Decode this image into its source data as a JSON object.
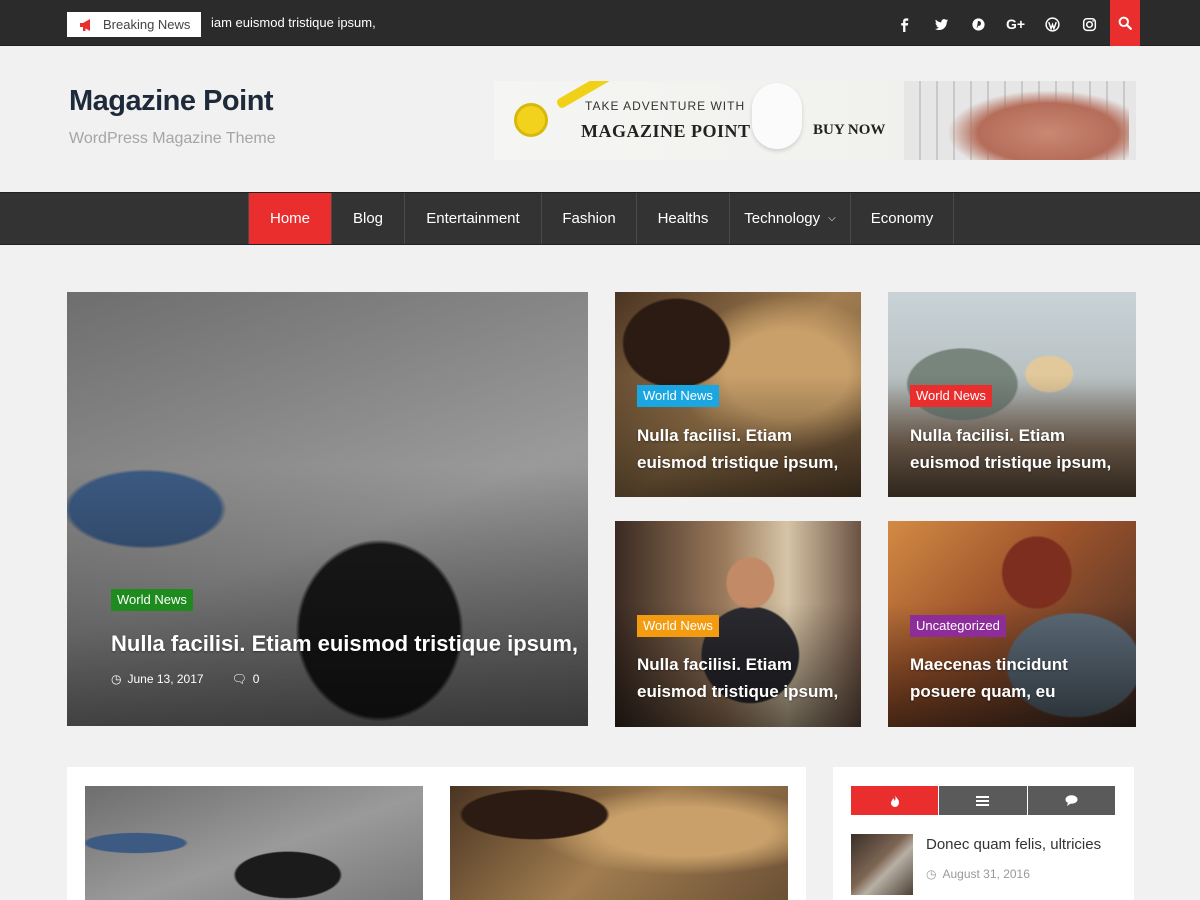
{
  "topbar": {
    "breaking_label": "Breaking News",
    "ticker_text": "iam euismod tristique ipsum,",
    "socials": [
      {
        "name": "facebook-icon",
        "glyph": "f"
      },
      {
        "name": "twitter-icon",
        "glyph": ""
      },
      {
        "name": "pinterest-icon",
        "glyph": ""
      },
      {
        "name": "google-plus-icon",
        "glyph": "G+"
      },
      {
        "name": "wordpress-icon",
        "glyph": ""
      },
      {
        "name": "instagram-icon",
        "glyph": ""
      }
    ],
    "accent_color": "#ea2e2e"
  },
  "header": {
    "site_title": "Magazine Point",
    "tagline": "WordPress Magazine Theme",
    "banner": {
      "kicker": "TAKE ADVENTURE WITH",
      "brand": "MAGAZINE POINT",
      "cta": "BUY NOW"
    }
  },
  "nav": {
    "items": [
      {
        "label": "Home",
        "active": true
      },
      {
        "label": "Blog"
      },
      {
        "label": "Entertainment"
      },
      {
        "label": "Fashion"
      },
      {
        "label": "Healths"
      },
      {
        "label": "Technology",
        "has_dropdown": true
      },
      {
        "label": "Economy"
      }
    ]
  },
  "featured": {
    "main": {
      "category": "World News",
      "category_color": "#1e8b1e",
      "title": "Nulla facilisi. Etiam euismod tristique ipsum,",
      "date": "June 13, 2017",
      "comments": "0"
    },
    "cards": [
      {
        "category": "World News",
        "category_color": "#1aa6e0",
        "title_line1": "Nulla facilisi. Etiam",
        "title_line2": "euismod tristique ipsum,"
      },
      {
        "category": "World News",
        "category_color": "#ea2e2e",
        "title_line1": "Nulla facilisi. Etiam",
        "title_line2": "euismod tristique ipsum,"
      },
      {
        "category": "World News",
        "category_color": "#f39c12",
        "title_line1": "Nulla facilisi. Etiam",
        "title_line2": "euismod tristique ipsum,"
      },
      {
        "category": "Uncategorized",
        "category_color": "#8e2d9a",
        "title_line1": "Maecenas tincidunt",
        "title_line2": "posuere quam, eu"
      }
    ]
  },
  "sidebar": {
    "tabs": [
      {
        "icon": "fire-icon",
        "active": true
      },
      {
        "icon": "list-icon"
      },
      {
        "icon": "comment-icon"
      }
    ],
    "post": {
      "title": "Donec quam felis, ultricies",
      "date": "August 31, 2016"
    }
  }
}
